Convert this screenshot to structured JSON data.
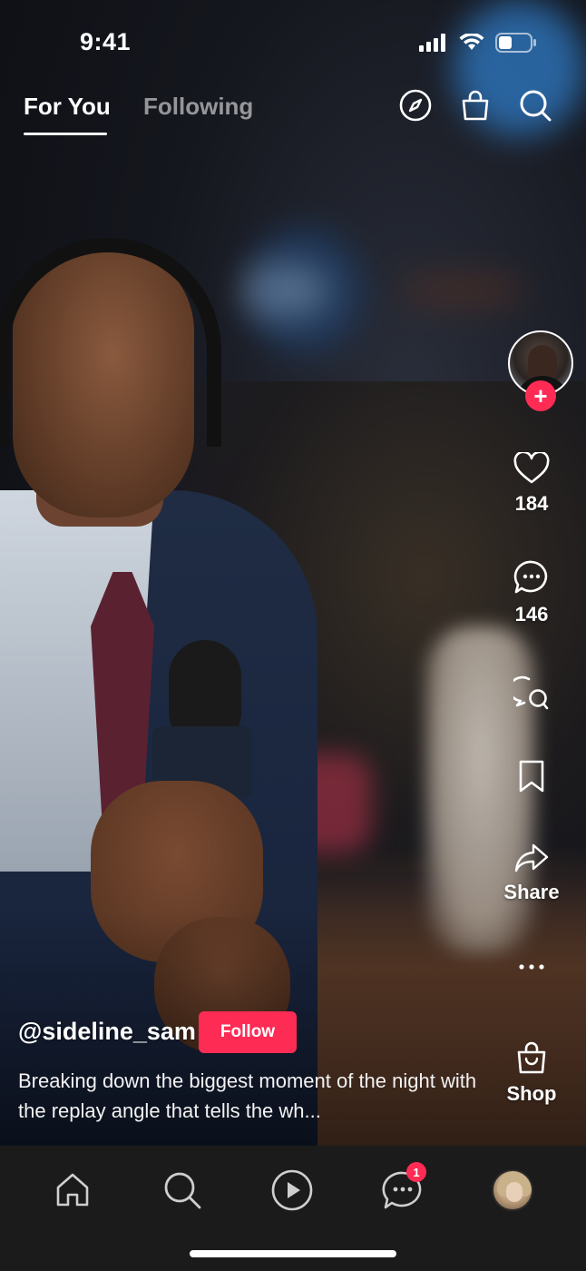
{
  "status_bar": {
    "time": "9:41"
  },
  "top_nav": {
    "tabs": [
      {
        "label": "For You",
        "active": true
      },
      {
        "label": "Following",
        "active": false
      }
    ],
    "icons": [
      "compass-icon",
      "shopping-bag-icon",
      "search-icon"
    ]
  },
  "rail": {
    "likes": "184",
    "comments": "146",
    "share_label": "Share",
    "shop_label": "Shop"
  },
  "post": {
    "username": "@sideline_sam",
    "follow_label": "Follow",
    "caption": "Breaking down the biggest moment of the night with the replay angle that tells the wh..."
  },
  "bottom_nav": {
    "items": [
      "home-icon",
      "search-icon",
      "play-icon",
      "inbox-icon",
      "profile-avatar"
    ],
    "inbox_badge": "1"
  },
  "colors": {
    "accent": "#fe2c55",
    "nav_bg": "#1b1b1c"
  }
}
